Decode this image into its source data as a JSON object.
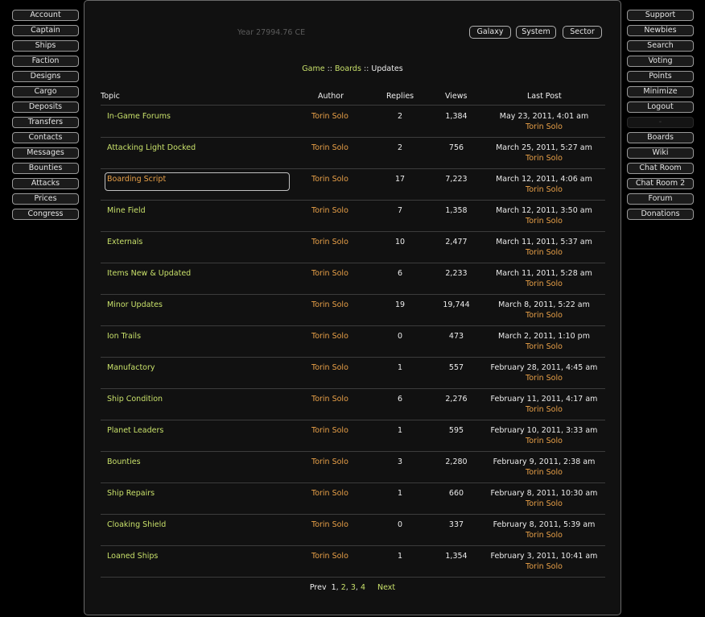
{
  "left_nav": [
    "Account",
    "Captain",
    "Ships",
    "Faction",
    "Designs",
    "Cargo",
    "Deposits",
    "Transfers",
    "Contacts",
    "Messages",
    "Bounties",
    "Attacks",
    "Prices",
    "Congress"
  ],
  "right_nav": [
    "Support",
    "Newbies",
    "Search",
    "Voting",
    "Points",
    "Minimize",
    "Logout",
    "-",
    "Boards",
    "Wiki",
    "Chat Room",
    "Chat Room 2",
    "Forum",
    "Donations"
  ],
  "header": {
    "year": "Year 27994.76 CE",
    "buttons": [
      "Galaxy",
      "System",
      "Sector"
    ]
  },
  "breadcrumb": {
    "game": "Game",
    "boards": "Boards",
    "current": "Updates",
    "separator": "::"
  },
  "table": {
    "columns": [
      "Topic",
      "Author",
      "Replies",
      "Views",
      "Last Post"
    ],
    "rows": [
      {
        "topic": "In-Game Forums",
        "author": "Torin Solo",
        "replies": "2",
        "views": "1,384",
        "last_date": "May 23, 2011, 4:01 am",
        "last_author": "Torin Solo"
      },
      {
        "topic": "Attacking Light Docked",
        "author": "Torin Solo",
        "replies": "2",
        "views": "756",
        "last_date": "March 25, 2011, 5:27 am",
        "last_author": "Torin Solo"
      },
      {
        "topic": "Boarding Script",
        "author": "Torin Solo",
        "replies": "17",
        "views": "7,223",
        "last_date": "March 12, 2011, 4:06 am",
        "last_author": "Torin Solo"
      },
      {
        "topic": "Mine Field",
        "author": "Torin Solo",
        "replies": "7",
        "views": "1,358",
        "last_date": "March 12, 2011, 3:50 am",
        "last_author": "Torin Solo"
      },
      {
        "topic": "Externals",
        "author": "Torin Solo",
        "replies": "10",
        "views": "2,477",
        "last_date": "March 11, 2011, 5:37 am",
        "last_author": "Torin Solo"
      },
      {
        "topic": "Items New & Updated",
        "author": "Torin Solo",
        "replies": "6",
        "views": "2,233",
        "last_date": "March 11, 2011, 5:28 am",
        "last_author": "Torin Solo"
      },
      {
        "topic": "Minor Updates",
        "author": "Torin Solo",
        "replies": "19",
        "views": "19,744",
        "last_date": "March 8, 2011, 5:22 am",
        "last_author": "Torin Solo"
      },
      {
        "topic": "Ion Trails",
        "author": "Torin Solo",
        "replies": "0",
        "views": "473",
        "last_date": "March 2, 2011, 1:10 pm",
        "last_author": "Torin Solo"
      },
      {
        "topic": "Manufactory",
        "author": "Torin Solo",
        "replies": "1",
        "views": "557",
        "last_date": "February 28, 2011, 4:45 am",
        "last_author": "Torin Solo"
      },
      {
        "topic": "Ship Condition",
        "author": "Torin Solo",
        "replies": "6",
        "views": "2,276",
        "last_date": "February 11, 2011, 4:17 am",
        "last_author": "Torin Solo"
      },
      {
        "topic": "Planet Leaders",
        "author": "Torin Solo",
        "replies": "1",
        "views": "595",
        "last_date": "February 10, 2011, 3:33 am",
        "last_author": "Torin Solo"
      },
      {
        "topic": "Bounties",
        "author": "Torin Solo",
        "replies": "3",
        "views": "2,280",
        "last_date": "February 9, 2011, 2:38 am",
        "last_author": "Torin Solo"
      },
      {
        "topic": "Ship Repairs",
        "author": "Torin Solo",
        "replies": "1",
        "views": "660",
        "last_date": "February 8, 2011, 10:30 am",
        "last_author": "Torin Solo"
      },
      {
        "topic": "Cloaking Shield",
        "author": "Torin Solo",
        "replies": "0",
        "views": "337",
        "last_date": "February 8, 2011, 5:39 am",
        "last_author": "Torin Solo"
      },
      {
        "topic": "Loaned Ships",
        "author": "Torin Solo",
        "replies": "1",
        "views": "1,354",
        "last_date": "February 3, 2011, 10:41 am",
        "last_author": "Torin Solo"
      }
    ]
  },
  "pager": {
    "prev": "Prev",
    "current": "1",
    "pages": [
      "2",
      "3",
      "4"
    ],
    "separator": ",",
    "next": "Next"
  },
  "colors": {
    "link_green": "#c8e06a",
    "author_orange": "#e8a048",
    "background": "#000000",
    "panel": "#111111"
  }
}
